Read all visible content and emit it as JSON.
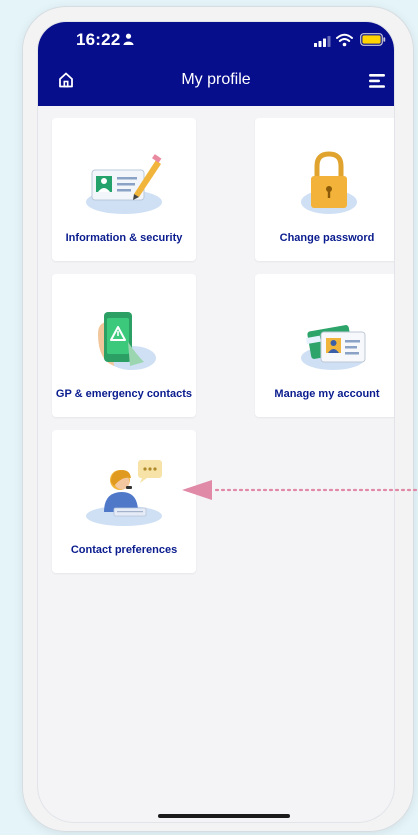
{
  "status_bar": {
    "time": "16:22"
  },
  "header": {
    "title": "My profile"
  },
  "tiles": [
    {
      "label": "Information & security"
    },
    {
      "label": "Change password"
    },
    {
      "label": "GP & emergency contacts"
    },
    {
      "label": "Manage my account"
    },
    {
      "label": "Contact preferences"
    }
  ],
  "icons": {
    "status_person": "person-icon",
    "signal": "signal-icon",
    "wifi": "wifi-icon",
    "battery": "battery-icon",
    "home": "home-icon",
    "menu": "menu-icon"
  },
  "colors": {
    "header_bg": "#070e8c",
    "tile_label": "#0a1c8e",
    "battery_fill": "#ffd400",
    "annotation_arrow": "#e08aa8"
  }
}
